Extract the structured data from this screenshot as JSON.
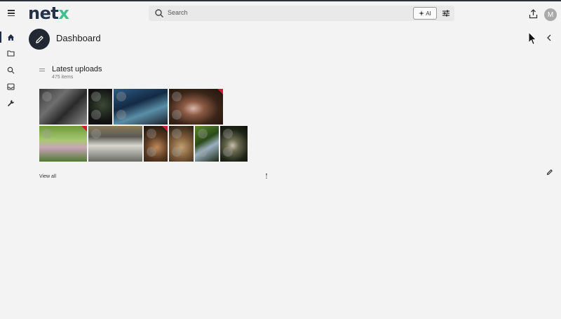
{
  "app": {
    "logo_main": "net",
    "logo_accent": "x"
  },
  "header": {
    "search_placeholder": "Search",
    "ai_label": "AI",
    "avatar_initial": "M"
  },
  "sidebar": {
    "items": [
      {
        "icon": "home-icon",
        "active": true
      },
      {
        "icon": "folder-icon",
        "active": false
      },
      {
        "icon": "search-icon",
        "active": false
      },
      {
        "icon": "inbox-icon",
        "active": false
      },
      {
        "icon": "wrench-icon",
        "active": false
      }
    ]
  },
  "page": {
    "title": "Dashboard"
  },
  "widget": {
    "title": "Latest uploads",
    "count": "475 items",
    "view_all": "View all"
  },
  "colors": {
    "brand_dark": "#26314a",
    "brand_accent": "#3fbf8f",
    "badge": "#d01838",
    "background": "#f3f3f3"
  }
}
